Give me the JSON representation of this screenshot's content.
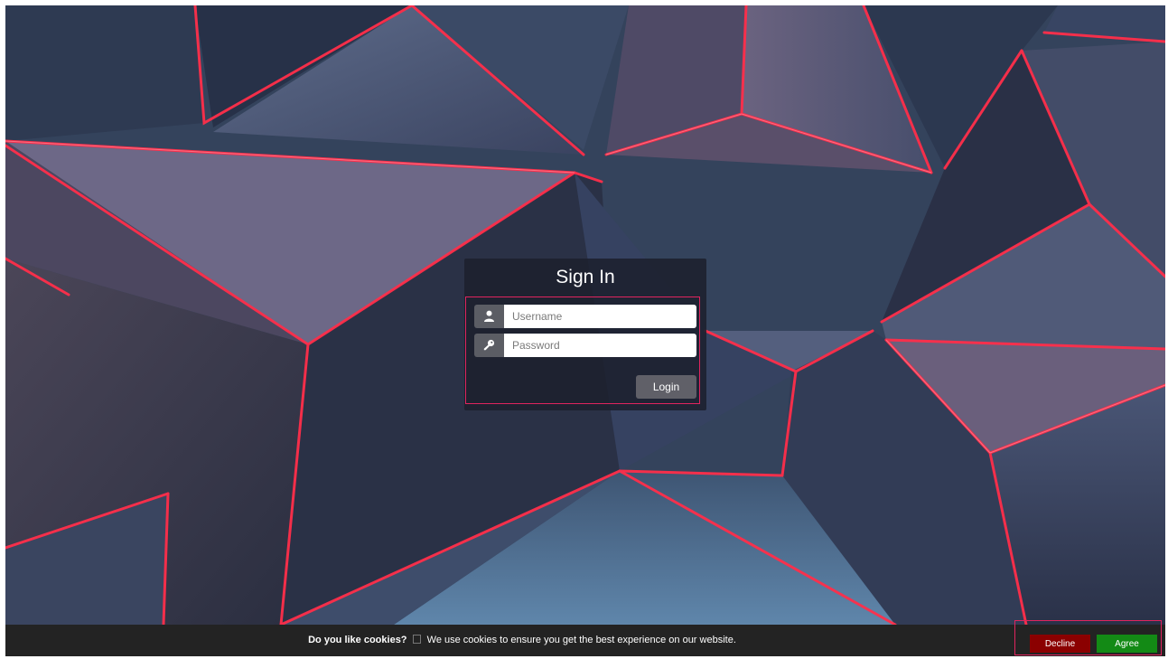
{
  "colors": {
    "accent": "#e0245e",
    "panel_bg": "#1c202d",
    "login_button": "#606068",
    "decline_button": "#8b0000",
    "agree_button": "#138a15",
    "cookie_bar": "#232323"
  },
  "login": {
    "title": "Sign In",
    "username": {
      "icon": "user-icon",
      "placeholder": "Username",
      "value": ""
    },
    "password": {
      "icon": "key-icon",
      "placeholder": "Password",
      "value": ""
    },
    "submit_label": "Login"
  },
  "cookie_banner": {
    "question": "Do you like cookies?",
    "icon": "cookie-icon",
    "message": "We use cookies to ensure you get the best experience on our website.",
    "decline_label": "Decline",
    "agree_label": "Agree"
  }
}
